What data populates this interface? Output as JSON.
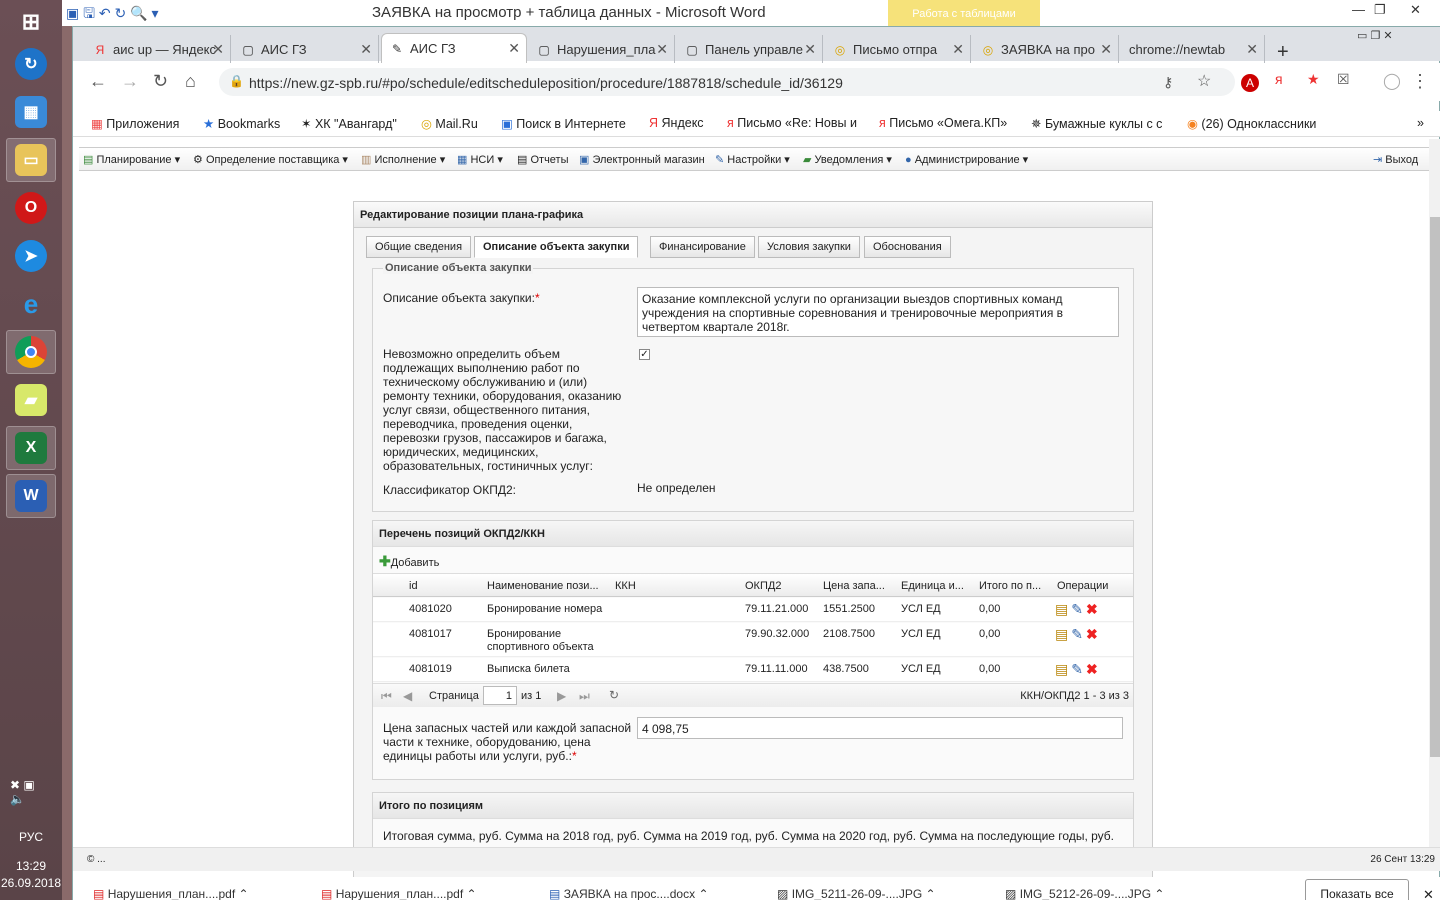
{
  "word": {
    "title": "ЗАЯВКА на просмотр + таблица данных - Microsoft Word",
    "table_tools": "Работа с таблицами"
  },
  "taskbar": {
    "lang": "РУС",
    "time": "13:29",
    "date": "26.09.2018"
  },
  "tabs": [
    {
      "label": "аис up — Яндекс",
      "icon": "Я"
    },
    {
      "label": "АИС ГЗ",
      "icon": "▢"
    },
    {
      "label": "АИС ГЗ",
      "icon": "✎"
    },
    {
      "label": "Нарушения_пла",
      "icon": "▢"
    },
    {
      "label": "Панель управле",
      "icon": "▢"
    },
    {
      "label": "Письмо отпра",
      "icon": "◎"
    },
    {
      "label": "ЗАЯВКА на про",
      "icon": "◎"
    },
    {
      "label": "chrome://newtab",
      "icon": ""
    }
  ],
  "url": "https://new.gz-spb.ru/#po/schedule/editscheduleposition/procedure/1887818/schedule_id/36129",
  "bookmarks": [
    "Приложения",
    "Bookmarks",
    "ХК \"Авангард\"",
    "Mail.Ru",
    "Поиск в Интернете",
    "Яндекс",
    "Письмо «Re: Новы и",
    "Письмо «Омега.КП»",
    "Бумажные куклы с с",
    "(26) Одноклассники"
  ],
  "menu": [
    "Планирование",
    "Определение поставщика",
    "Исполнение",
    "НСИ",
    "Отчеты",
    "Электронный магазин",
    "Настройки",
    "Уведомления",
    "Администрирование"
  ],
  "exit": "Выход",
  "panel": {
    "title": "Редактирование позиции плана-графика",
    "tabs": [
      "Общие сведения",
      "Описание объекта закупки",
      "Финансирование",
      "Условия закупки",
      "Обоснования"
    ],
    "legend": "Описание объекта закупки",
    "desc_label": "Описание объекта закупки:",
    "desc_value": "Оказание комплексной услуги по организации выездов спортивных команд учреждения на спортивные соревнования и тренировочные мероприятия в четвертом квартале 2018г.",
    "volume_label": "Невозможно определить объем подлежащих выполнению работ по техническому обслуживанию и (или) ремонту техники, оборудования, оказанию услуг связи, общественного питания, переводчика, проведения оценки, перевозки грузов, пассажиров и багажа, юридических, медицинских, образовательных, гостиничных услуг:",
    "okpd_label": "Классификатор ОКПД2:",
    "okpd_value": "Не определен",
    "grid_title": "Перечень позиций ОКПД2/ККН",
    "add": "Добавить",
    "columns": [
      "id",
      "Наименование пози...",
      "ККН",
      "ОКПД2",
      "Цена запа...",
      "Единица и...",
      "Итого по п...",
      "Операции"
    ],
    "rows": [
      {
        "id": "4081020",
        "name": "Бронирование номера",
        "kkn": "",
        "okpd": "79.11.21.000",
        "price": "1551.2500",
        "unit": "УСЛ ЕД",
        "total": "0,00"
      },
      {
        "id": "4081017",
        "name": "Бронирование спортивного объекта",
        "kkn": "",
        "okpd": "79.90.32.000",
        "price": "2108.7500",
        "unit": "УСЛ ЕД",
        "total": "0,00"
      },
      {
        "id": "4081019",
        "name": "Выписка билета",
        "kkn": "",
        "okpd": "79.11.11.000",
        "price": "438.7500",
        "unit": "УСЛ ЕД",
        "total": "0,00"
      }
    ],
    "pager": {
      "page_label": "Страница",
      "page": "1",
      "of": "из 1",
      "summary": "ККН/ОКПД2 1 - 3 из 3"
    },
    "price_label": "Цена запасных частей или каждой запасной части к технике, оборудованию, цена единицы работы или услуги, руб.:",
    "price_value": "4 098,75",
    "totals_title": "Итого по позициям",
    "totals_cols": "Итоговая сумма, руб.  Сумма на 2018 год, руб.  Сумма на 2019 год, руб.  Сумма на 2020 год, руб.  Сумма на последующие годы, руб."
  },
  "footer": {
    "left": "© ...",
    "right": "26 Сент 13:29"
  },
  "downloads": [
    "Нарушения_план....pdf",
    "Нарушения_план....pdf",
    "ЗАЯВКА на прос....docx",
    "IMG_5211-26-09-....JPG",
    "IMG_5212-26-09-....JPG"
  ],
  "show_all": "Показать все"
}
